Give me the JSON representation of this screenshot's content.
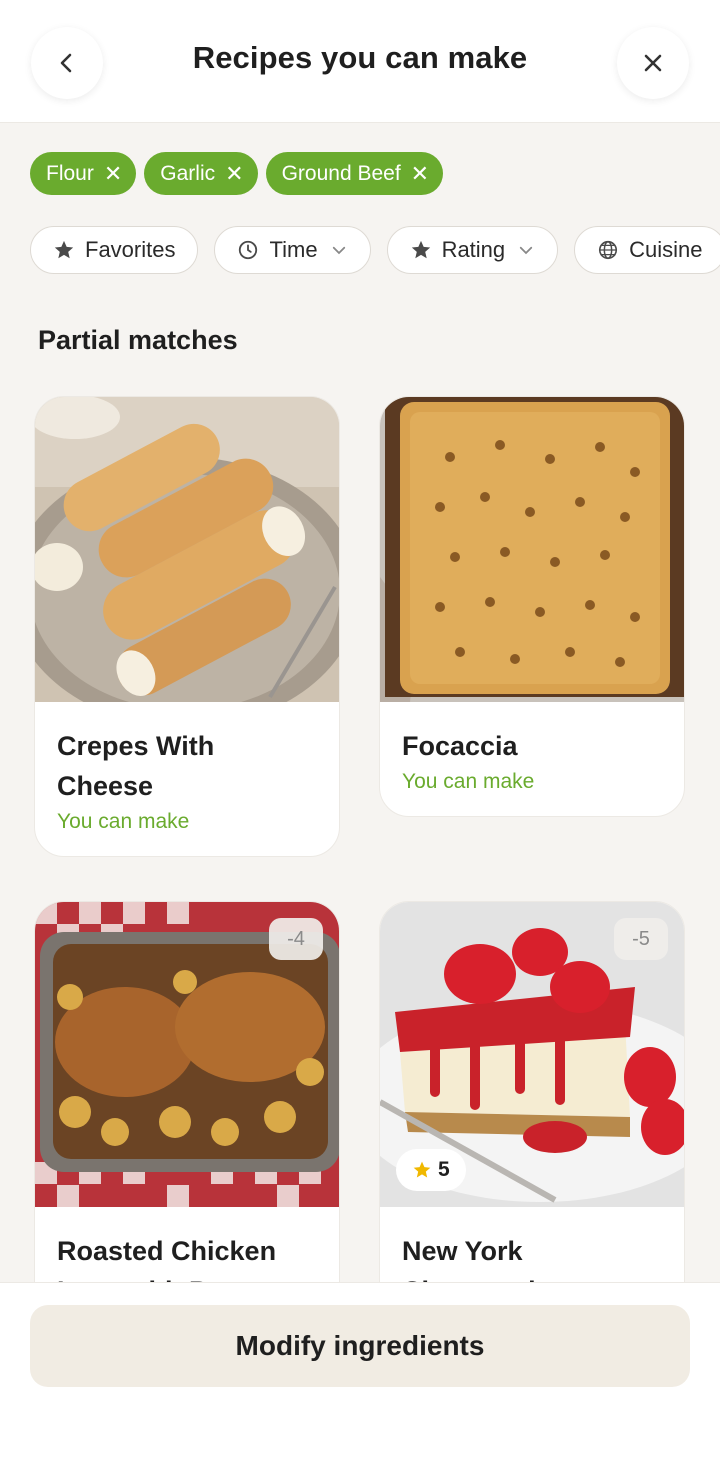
{
  "header": {
    "title": "Recipes you can make",
    "back_icon": "chevron-left-icon",
    "close_icon": "close-icon"
  },
  "ingredient_chips": [
    {
      "label": "Flour"
    },
    {
      "label": "Garlic"
    },
    {
      "label": "Ground Beef"
    }
  ],
  "filters": [
    {
      "label": "Favorites",
      "icon": "star-icon",
      "dropdown": false
    },
    {
      "label": "Time",
      "icon": "clock-icon",
      "dropdown": true
    },
    {
      "label": "Rating",
      "icon": "star-icon",
      "dropdown": true
    },
    {
      "label": "Cuisine",
      "icon": "globe-icon",
      "dropdown": false
    }
  ],
  "section": {
    "title": "Partial matches"
  },
  "recipes": [
    {
      "name": "Crepes With Cheese",
      "status": "You can make"
    },
    {
      "name": "Focaccia",
      "status": "You can make"
    },
    {
      "name": "Roasted Chicken Legs with Potatoes",
      "missing_badge": "-4"
    },
    {
      "name": "New York Cheesecake",
      "missing_badge": "-5",
      "rating": "5"
    }
  ],
  "bottom": {
    "button_label": "Modify ingredients"
  },
  "colors": {
    "accent_green": "#6aab2e",
    "star_gold": "#f0b800",
    "button_bg": "#f1ece3"
  }
}
